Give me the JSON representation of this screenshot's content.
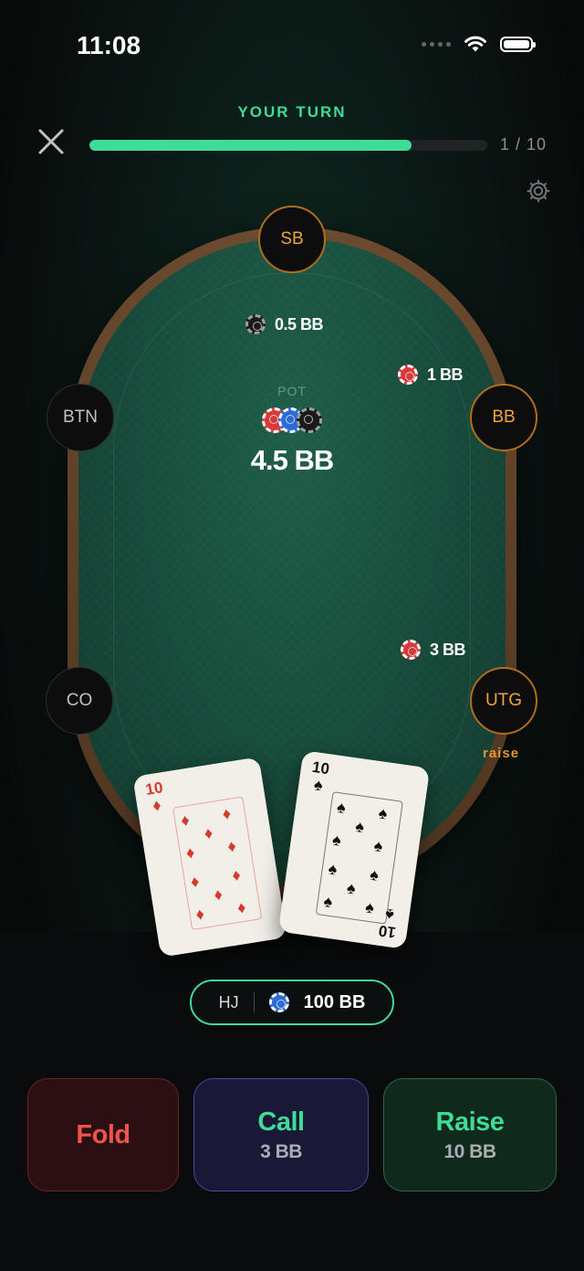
{
  "status": {
    "time": "11:08"
  },
  "header": {
    "turn_label": "YOUR TURN",
    "progress": {
      "current": 1,
      "total": 10,
      "fraction": 0.81,
      "text": "1 / 10"
    }
  },
  "seats": {
    "sb": {
      "label": "SB"
    },
    "bb": {
      "label": "BB"
    },
    "btn": {
      "label": "BTN"
    },
    "co": {
      "label": "CO"
    },
    "utg": {
      "label": "UTG",
      "note": "raise"
    }
  },
  "bets": {
    "sb": "0.5 BB",
    "bb": "1 BB",
    "utg": "3 BB"
  },
  "pot": {
    "label": "POT",
    "amount": "4.5 BB"
  },
  "hand": [
    {
      "rank": "10",
      "suit": "♦",
      "color": "#d43a2e"
    },
    {
      "rank": "10",
      "suit": "♠",
      "color": "#111111"
    }
  ],
  "hero": {
    "position": "HJ",
    "stack": "100 BB"
  },
  "actions": {
    "fold": {
      "label": "Fold"
    },
    "call": {
      "label": "Call",
      "amount": "3 BB"
    },
    "raise": {
      "label": "Raise",
      "amount": "10 BB"
    }
  },
  "colors": {
    "accent": "#3ddc97",
    "fold": "#ef5350",
    "active_seat": "#f0a43a"
  }
}
